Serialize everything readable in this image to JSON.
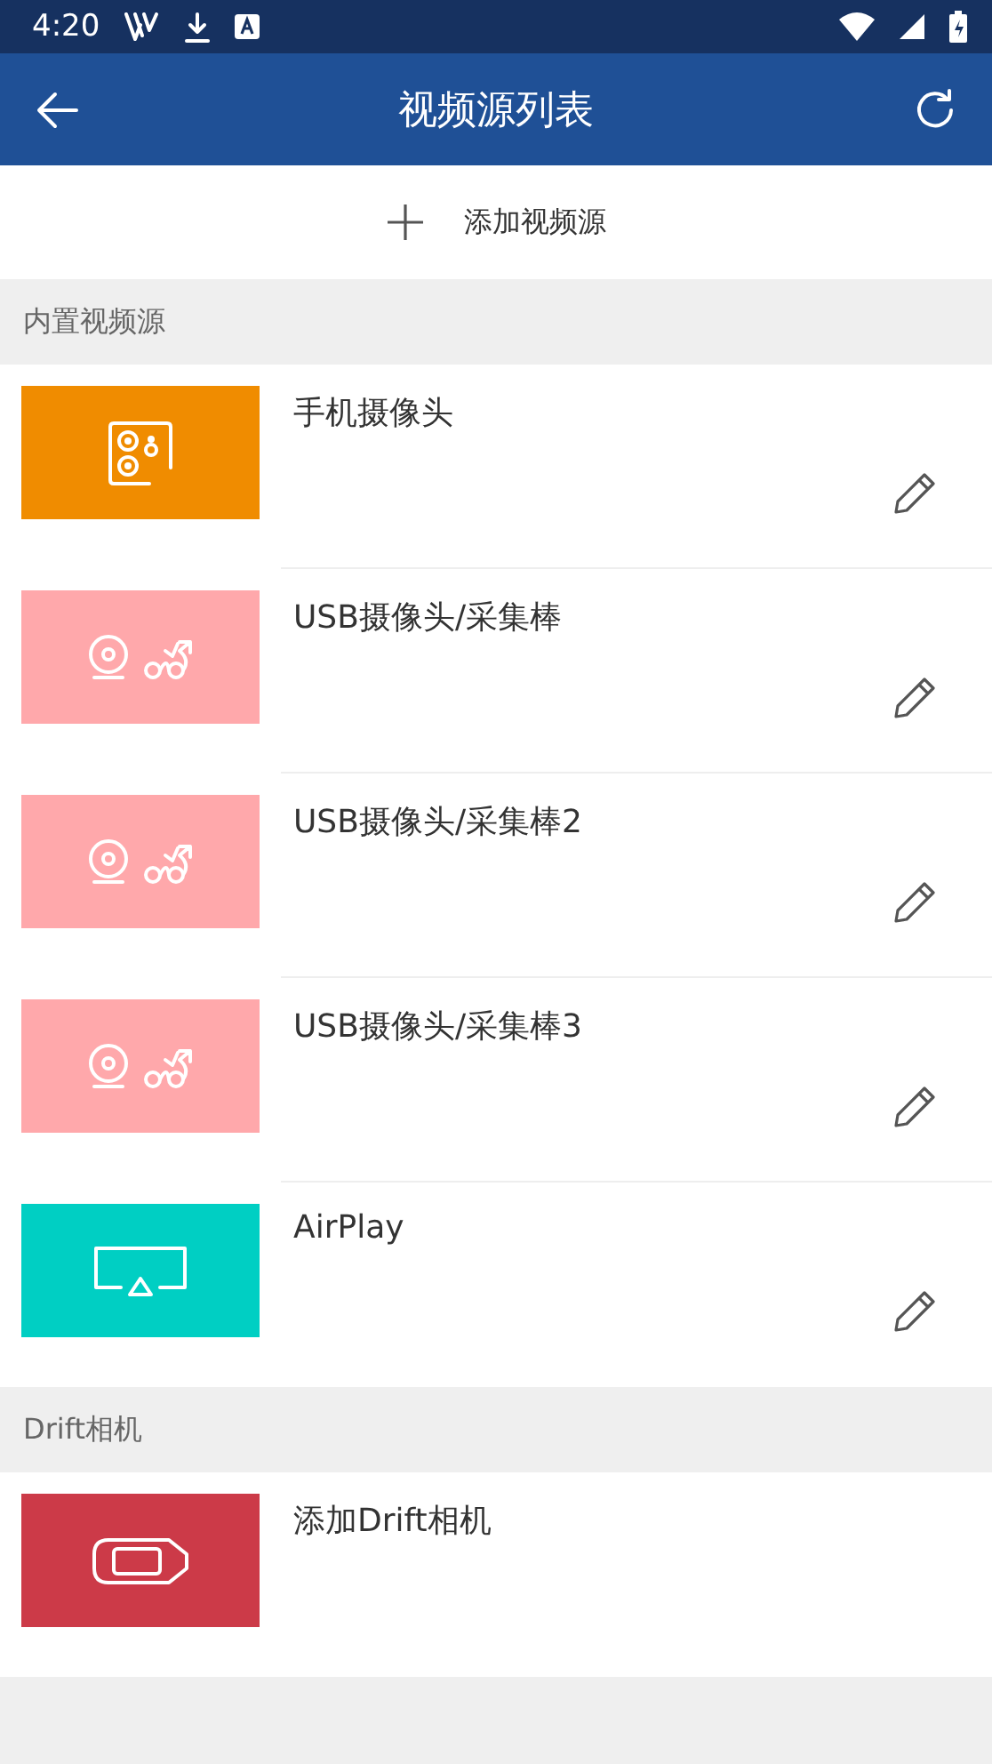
{
  "status_bar": {
    "time": "4:20"
  },
  "app_bar": {
    "title": "视频源列表"
  },
  "add_source": {
    "label": "添加视频源"
  },
  "sections": [
    {
      "title": "内置视频源",
      "items": [
        {
          "kind": "phone",
          "title": "手机摄像头",
          "color": "#f08c00",
          "editable": true
        },
        {
          "kind": "usb",
          "title": "USB摄像头/采集棒",
          "color": "#ffa8ab",
          "editable": true
        },
        {
          "kind": "usb",
          "title": "USB摄像头/采集棒2",
          "color": "#ffa8ab",
          "editable": true
        },
        {
          "kind": "usb",
          "title": "USB摄像头/采集棒3",
          "color": "#ffa8ab",
          "editable": true
        },
        {
          "kind": "airplay",
          "title": "AirPlay",
          "color": "#00cfc3",
          "editable": true
        }
      ]
    },
    {
      "title": "Drift相机",
      "items": [
        {
          "kind": "drift",
          "title": "添加Drift相机",
          "color": "#cc3a48",
          "editable": false
        }
      ]
    }
  ]
}
